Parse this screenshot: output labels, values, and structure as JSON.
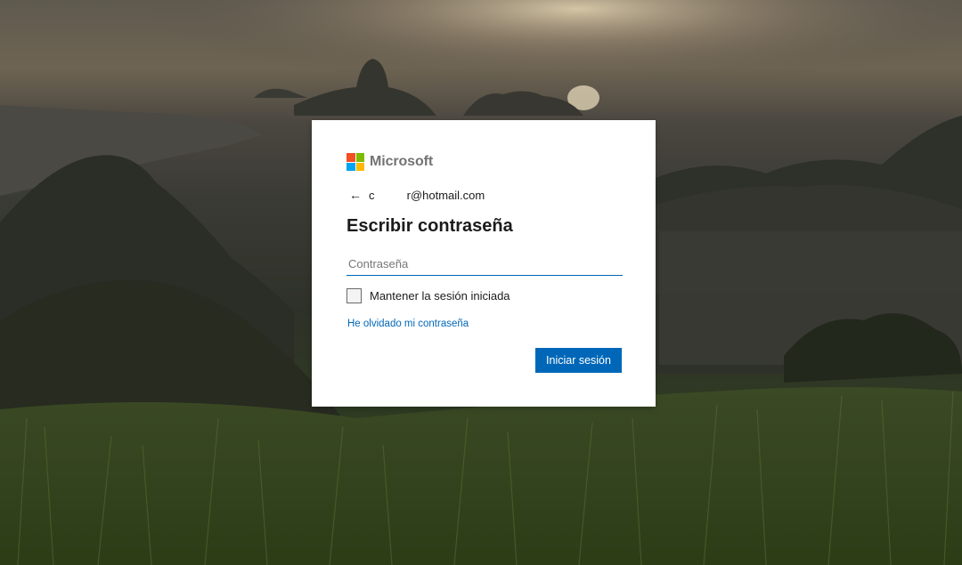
{
  "brand": {
    "name": "Microsoft",
    "logo_colors": [
      "#f25022",
      "#7fba00",
      "#00a4ef",
      "#ffb900"
    ]
  },
  "identity": {
    "back_icon": "arrow-left-icon",
    "email": "c          r@hotmail.com"
  },
  "title": "Escribir contraseña",
  "password_field": {
    "placeholder": "Contraseña",
    "value": ""
  },
  "keep_signed_in": {
    "label": "Mantener la sesión iniciada",
    "checked": false
  },
  "forgot_link": "He olvidado mi contraseña",
  "submit_label": "Iniciar sesión",
  "colors": {
    "accent": "#0067b8",
    "text": "#1b1b1b"
  }
}
